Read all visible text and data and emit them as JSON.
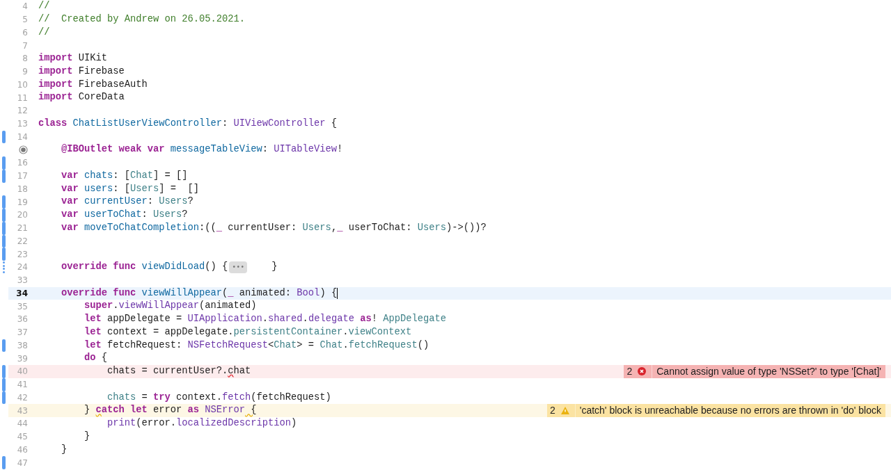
{
  "lines": [
    {
      "number": "4",
      "kind": "normal",
      "changed": false,
      "tokens": [
        {
          "text": "//",
          "kind": "comment"
        }
      ]
    },
    {
      "number": "5",
      "kind": "normal",
      "changed": false,
      "tokens": [
        {
          "text": "//  Created by Andrew on 26.05.2021.",
          "kind": "comment"
        }
      ]
    },
    {
      "number": "6",
      "kind": "normal",
      "changed": false,
      "tokens": [
        {
          "text": "//",
          "kind": "comment"
        }
      ]
    },
    {
      "number": "7",
      "kind": "normal",
      "changed": false
    },
    {
      "number": "8",
      "kind": "normal",
      "changed": false,
      "tokens": [
        {
          "text": "import",
          "kind": "keyword"
        },
        {
          "text": " UIKit",
          "kind": "plain"
        }
      ]
    },
    {
      "number": "9",
      "kind": "normal",
      "changed": false,
      "tokens": [
        {
          "text": "import",
          "kind": "keyword"
        },
        {
          "text": " Firebase",
          "kind": "plain"
        }
      ]
    },
    {
      "number": "10",
      "kind": "normal",
      "changed": false,
      "tokens": [
        {
          "text": "import",
          "kind": "keyword"
        },
        {
          "text": " FirebaseAuth",
          "kind": "plain"
        }
      ]
    },
    {
      "number": "11",
      "kind": "normal",
      "changed": false,
      "tokens": [
        {
          "text": "import",
          "kind": "keyword"
        },
        {
          "text": " CoreData",
          "kind": "plain"
        }
      ]
    },
    {
      "number": "12",
      "kind": "normal",
      "changed": false
    },
    {
      "number": "13",
      "kind": "normal",
      "changed": false,
      "tokens": [
        {
          "text": "class ",
          "kind": "keyword"
        },
        {
          "text": "ChatListUserViewController",
          "kind": "declaration"
        },
        {
          "text": ": ",
          "kind": "plain"
        },
        {
          "text": "UIViewController",
          "kind": "system"
        },
        {
          "text": " {",
          "kind": "plain"
        }
      ]
    },
    {
      "number": "14",
      "kind": "normal",
      "changed": true
    },
    {
      "kind": "normal",
      "changed": false,
      "outlet": true,
      "tokens": [
        {
          "text": "    @IBOutlet weak var ",
          "kind": "keyword"
        },
        {
          "text": "messageTableView",
          "kind": "declaration"
        },
        {
          "text": ": ",
          "kind": "plain"
        },
        {
          "text": "UITableView",
          "kind": "system"
        },
        {
          "text": "!",
          "kind": "plain"
        }
      ]
    },
    {
      "number": "16",
      "kind": "normal",
      "changed": true
    },
    {
      "number": "17",
      "kind": "normal",
      "changed": true,
      "tokens": [
        {
          "text": "    var ",
          "kind": "keyword"
        },
        {
          "text": "chats",
          "kind": "declaration"
        },
        {
          "text": ": [",
          "kind": "plain"
        },
        {
          "text": "Chat",
          "kind": "project"
        },
        {
          "text": "] = []",
          "kind": "plain"
        }
      ]
    },
    {
      "number": "18",
      "kind": "normal",
      "changed": false,
      "tokens": [
        {
          "text": "    var ",
          "kind": "keyword"
        },
        {
          "text": "users",
          "kind": "declaration"
        },
        {
          "text": ": [",
          "kind": "plain"
        },
        {
          "text": "Users",
          "kind": "project"
        },
        {
          "text": "] =  []",
          "kind": "plain"
        }
      ]
    },
    {
      "number": "19",
      "kind": "normal",
      "changed": true,
      "tokens": [
        {
          "text": "    var ",
          "kind": "keyword"
        },
        {
          "text": "currentUser",
          "kind": "declaration"
        },
        {
          "text": ": ",
          "kind": "plain"
        },
        {
          "text": "Users",
          "kind": "project"
        },
        {
          "text": "?",
          "kind": "plain"
        }
      ]
    },
    {
      "number": "20",
      "kind": "normal",
      "changed": true,
      "tokens": [
        {
          "text": "    var ",
          "kind": "keyword"
        },
        {
          "text": "userToChat",
          "kind": "declaration"
        },
        {
          "text": ": ",
          "kind": "plain"
        },
        {
          "text": "Users",
          "kind": "project"
        },
        {
          "text": "?",
          "kind": "plain"
        }
      ]
    },
    {
      "number": "21",
      "kind": "normal",
      "changed": true,
      "tokens": [
        {
          "text": "    var ",
          "kind": "keyword"
        },
        {
          "text": "moveToChatCompletion",
          "kind": "declaration"
        },
        {
          "text": ":((",
          "kind": "plain"
        },
        {
          "text": "_",
          "kind": "keyword"
        },
        {
          "text": " currentUser: ",
          "kind": "plain"
        },
        {
          "text": "Users",
          "kind": "project"
        },
        {
          "text": ",",
          "kind": "plain"
        },
        {
          "text": "_",
          "kind": "keyword"
        },
        {
          "text": " userToChat: ",
          "kind": "plain"
        },
        {
          "text": "Users",
          "kind": "project"
        },
        {
          "text": ")->())?",
          "kind": "plain"
        }
      ]
    },
    {
      "number": "22",
      "kind": "normal",
      "changed": true
    },
    {
      "number": "23",
      "kind": "normal",
      "changed": true
    },
    {
      "number": "24",
      "kind": "normal",
      "changed": true,
      "tokens": [
        {
          "text": "    override func ",
          "kind": "keyword"
        },
        {
          "text": "viewDidLoad",
          "kind": "declaration"
        },
        {
          "text": "() {",
          "kind": "plain"
        },
        {
          "text": "•••",
          "kind": "fold"
        },
        {
          "text": "    }",
          "kind": "plain"
        }
      ]
    },
    {
      "number": "33",
      "kind": "normal",
      "changed": false
    },
    {
      "number": "34",
      "kind": "current",
      "changed": false,
      "tokens": [
        {
          "text": "    override func ",
          "kind": "keyword"
        },
        {
          "text": "viewWillAppear",
          "kind": "declaration"
        },
        {
          "text": "(",
          "kind": "plain"
        },
        {
          "text": "_",
          "kind": "keyword"
        },
        {
          "text": " animated: ",
          "kind": "plain"
        },
        {
          "text": "Bool",
          "kind": "system"
        },
        {
          "text": ") {",
          "kind": "plain"
        }
      ]
    },
    {
      "number": "35",
      "kind": "normal",
      "changed": false,
      "tokens": [
        {
          "text": "        super",
          "kind": "keyword"
        },
        {
          "text": ".",
          "kind": "plain"
        },
        {
          "text": "viewWillAppear",
          "kind": "system"
        },
        {
          "text": "(animated)",
          "kind": "plain"
        }
      ]
    },
    {
      "number": "36",
      "kind": "normal",
      "changed": false,
      "tokens": [
        {
          "text": "        let",
          "kind": "keyword"
        },
        {
          "text": " appDelegate = ",
          "kind": "plain"
        },
        {
          "text": "UIApplication",
          "kind": "system"
        },
        {
          "text": ".",
          "kind": "plain"
        },
        {
          "text": "shared",
          "kind": "system"
        },
        {
          "text": ".",
          "kind": "plain"
        },
        {
          "text": "delegate",
          "kind": "system"
        },
        {
          "text": " as",
          "kind": "keyword"
        },
        {
          "text": "! ",
          "kind": "plain"
        },
        {
          "text": "AppDelegate",
          "kind": "project"
        }
      ]
    },
    {
      "number": "37",
      "kind": "normal",
      "changed": false,
      "tokens": [
        {
          "text": "        let",
          "kind": "keyword"
        },
        {
          "text": " context = appDelegate.",
          "kind": "plain"
        },
        {
          "text": "persistentContainer",
          "kind": "project"
        },
        {
          "text": ".",
          "kind": "plain"
        },
        {
          "text": "viewContext",
          "kind": "project"
        }
      ]
    },
    {
      "number": "38",
      "kind": "normal",
      "changed": true,
      "tokens": [
        {
          "text": "        let",
          "kind": "keyword"
        },
        {
          "text": " fetchRequest: ",
          "kind": "plain"
        },
        {
          "text": "NSFetchRequest",
          "kind": "system"
        },
        {
          "text": "<",
          "kind": "plain"
        },
        {
          "text": "Chat",
          "kind": "project"
        },
        {
          "text": "> = ",
          "kind": "plain"
        },
        {
          "text": "Chat",
          "kind": "project"
        },
        {
          "text": ".",
          "kind": "plain"
        },
        {
          "text": "fetchRequest",
          "kind": "project"
        },
        {
          "text": "()",
          "kind": "plain"
        }
      ]
    },
    {
      "number": "39",
      "kind": "normal",
      "changed": false,
      "tokens": [
        {
          "text": "        do",
          "kind": "keyword"
        },
        {
          "text": " {",
          "kind": "plain"
        }
      ]
    },
    {
      "number": "40",
      "kind": "error",
      "changed": true,
      "tokens": [
        {
          "text": "            chats = currentUser?.",
          "kind": "plain"
        },
        {
          "text": "c",
          "kind": "plain",
          "squiggle": true
        },
        {
          "text": "hat",
          "kind": "plain"
        }
      ],
      "issue": {
        "count": "2",
        "message": "Cannot assign value of type 'NSSet?' to type '[Chat]'"
      }
    },
    {
      "number": "41",
      "kind": "normal",
      "changed": true
    },
    {
      "number": "42",
      "kind": "normal",
      "changed": true,
      "tokens": [
        {
          "text": "            chats",
          "kind": "project"
        },
        {
          "text": " = ",
          "kind": "plain"
        },
        {
          "text": "try",
          "kind": "keyword"
        },
        {
          "text": " context.",
          "kind": "plain"
        },
        {
          "text": "fetch",
          "kind": "system"
        },
        {
          "text": "(fetchRequest)",
          "kind": "plain"
        }
      ]
    },
    {
      "number": "43",
      "kind": "warning",
      "changed": false,
      "tokens": [
        {
          "text": "        } ",
          "kind": "plain"
        },
        {
          "text": "c",
          "kind": "keyword",
          "squiggle": true
        },
        {
          "text": "atch let",
          "kind": "keyword"
        },
        {
          "text": " error ",
          "kind": "plain"
        },
        {
          "text": "as",
          "kind": "keyword"
        },
        {
          "text": " NSError",
          "kind": "system"
        },
        {
          "text": " {",
          "kind": "plain",
          "squiggle": true
        }
      ],
      "issue": {
        "count": "2",
        "message": "'catch' block is unreachable because no errors are thrown in 'do' block"
      }
    },
    {
      "number": "44",
      "kind": "normal",
      "changed": false,
      "tokens": [
        {
          "text": "            print",
          "kind": "system"
        },
        {
          "text": "(error.",
          "kind": "plain"
        },
        {
          "text": "localizedDescription",
          "kind": "system"
        },
        {
          "text": ")",
          "kind": "plain"
        }
      ]
    },
    {
      "number": "45",
      "kind": "normal",
      "changed": false,
      "tokens": [
        {
          "text": "        }",
          "kind": "plain"
        }
      ]
    },
    {
      "number": "46",
      "kind": "normal",
      "changed": false,
      "tokens": [
        {
          "text": "    }",
          "kind": "plain"
        }
      ]
    },
    {
      "number": "47",
      "kind": "normal",
      "changed": true
    }
  ]
}
